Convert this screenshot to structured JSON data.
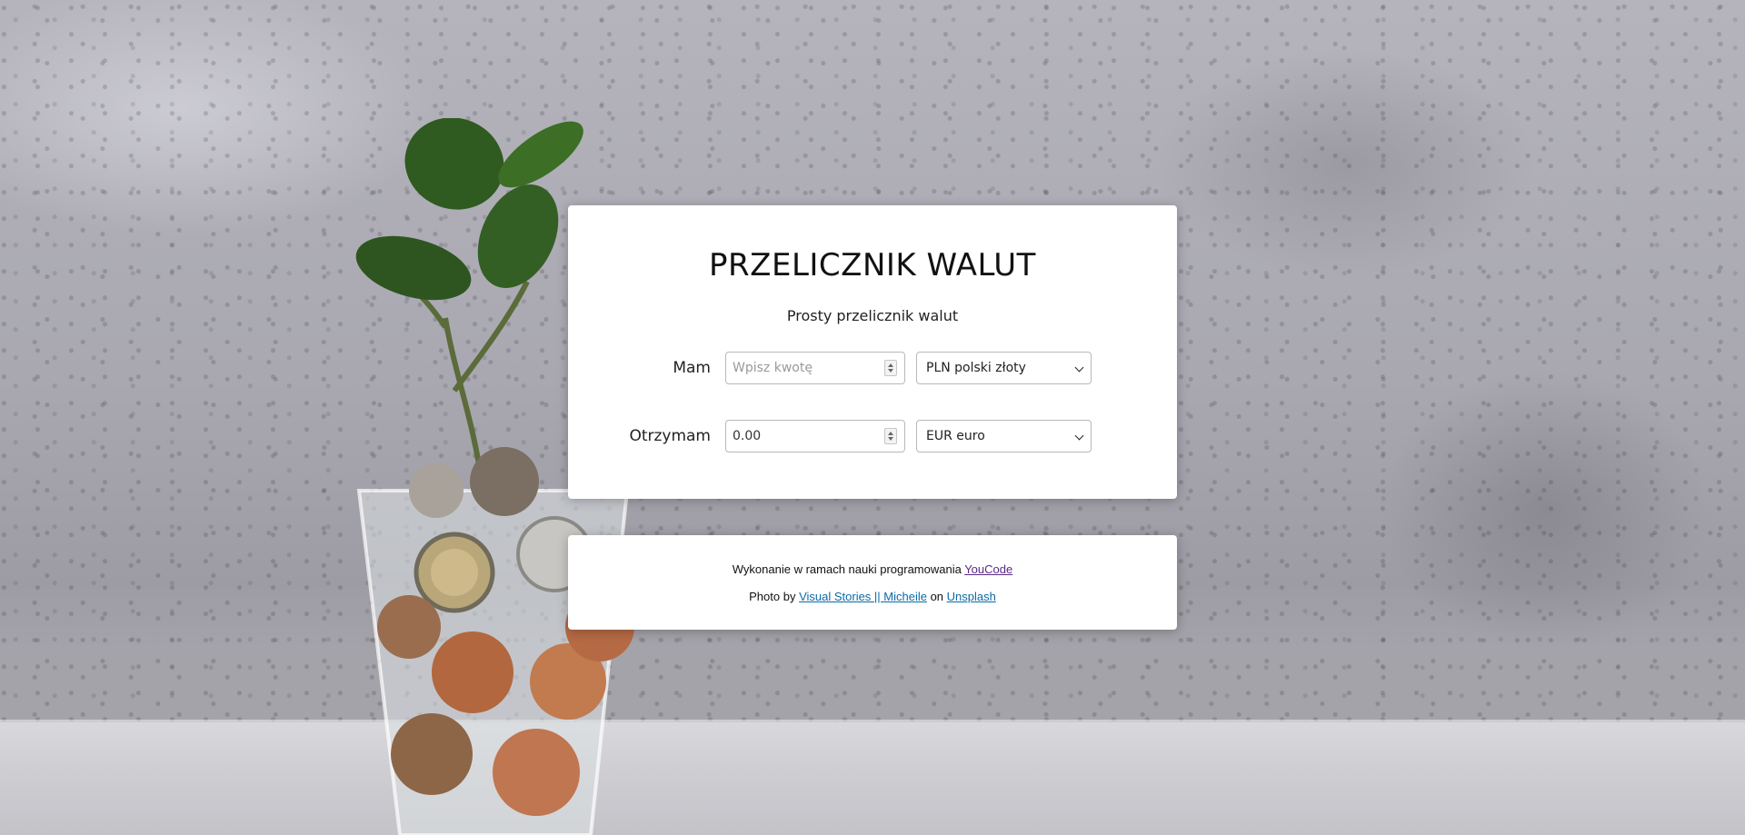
{
  "header": {
    "title": "PRZELICZNIK WALUT",
    "subtitle": "Prosty przelicznik walut"
  },
  "form": {
    "have": {
      "label": "Mam",
      "input_value": "",
      "input_placeholder": "Wpisz kwotę",
      "currency_selected": "PLN polski złoty"
    },
    "get": {
      "label": "Otrzymam",
      "input_value": "0.00",
      "input_placeholder": "",
      "currency_selected": "EUR euro"
    }
  },
  "footer": {
    "line1_text": "Wykonanie w ramach nauki programowania ",
    "line1_link": "YouCode",
    "line2_prefix": "Photo by ",
    "line2_author_link": "Visual Stories || Micheile",
    "line2_middle": " on ",
    "line2_site_link": "Unsplash"
  },
  "colors": {
    "card_background": "#ffffff",
    "link": "#0c6aa6",
    "visited_link": "#5b2a86",
    "text": "#111111"
  },
  "icons": {
    "select_arrow": "chevron-down-icon",
    "number_spinner": "spinner-icon"
  }
}
